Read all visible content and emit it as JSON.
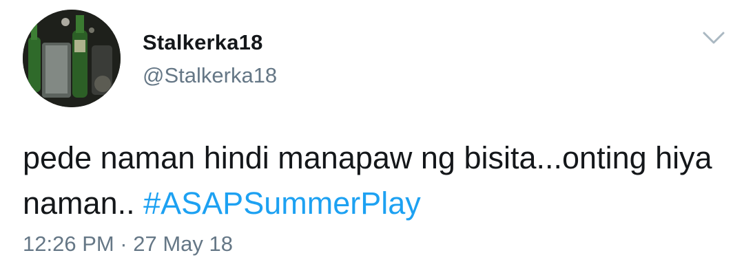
{
  "user": {
    "display_name": "Stalkerka18",
    "handle": "@Stalkerka18"
  },
  "tweet": {
    "text_part1": "pede naman hindi manapaw ng bisita...onting hiya naman.. ",
    "hashtag": "#ASAPSummerPlay",
    "timestamp": "12:26 PM · 27 May 18"
  },
  "icons": {
    "menu": "chevron-down-icon",
    "avatar": "avatar"
  },
  "colors": {
    "text": "#14171a",
    "secondary": "#657786",
    "link": "#1da1f2"
  }
}
